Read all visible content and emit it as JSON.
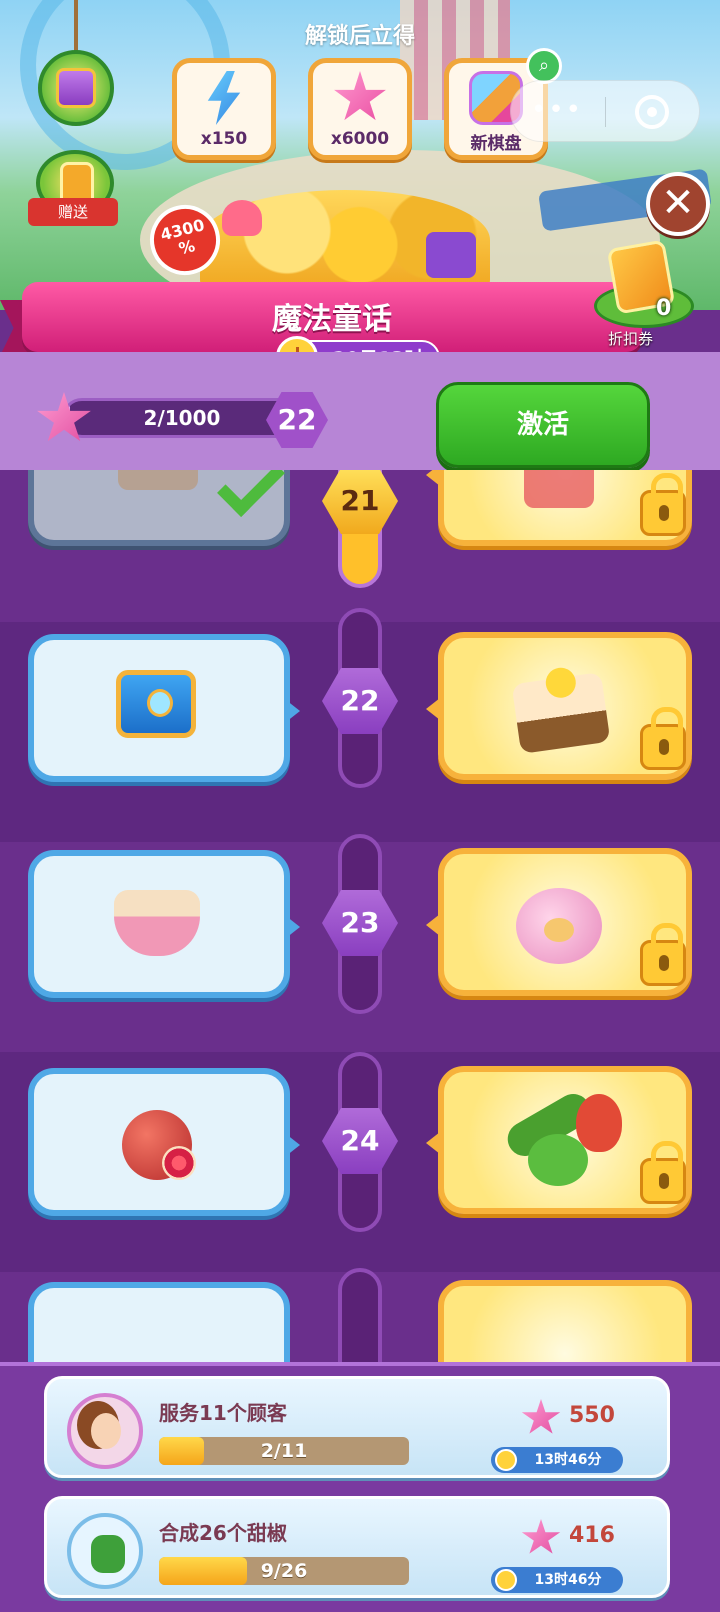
{
  "header": {
    "unlock_title": "解锁后立得",
    "rewards": [
      {
        "label": "x150",
        "icon": "energy-bolt-icon"
      },
      {
        "label": "x6000",
        "icon": "pink-star-icon"
      },
      {
        "label": "新棋盘",
        "icon": "new-board-icon"
      }
    ],
    "gift_label": "赠送",
    "percent_badge": "4300 %",
    "coupon": {
      "count": "0",
      "label": "折扣券"
    }
  },
  "event": {
    "title": "魔法童话",
    "time_left": "20日13时"
  },
  "progress": {
    "text": "2/1000",
    "value": 2,
    "max": 1000,
    "level": "22",
    "activate_label": "激活"
  },
  "levels": [
    {
      "level": "21",
      "free_item": "mystery-box-icon",
      "premium_item": "red-chest-icon",
      "claimed": true,
      "locked": true
    },
    {
      "level": "22",
      "free_item": "blue-chest-icon",
      "premium_item": "flower-cake-icon",
      "claimed": false,
      "locked": true
    },
    {
      "level": "23",
      "free_item": "rice-bowl-icon",
      "premium_item": "piggy-bank-icon",
      "claimed": false,
      "locked": true
    },
    {
      "level": "24",
      "free_item": "pomegranate-icon",
      "premium_item": "vegetables-icon",
      "claimed": false,
      "locked": true
    }
  ],
  "tasks": [
    {
      "title": "服务11个顾客",
      "progress_text": "2/11",
      "progress": 0.18,
      "reward": "550",
      "timer": "13时46分"
    },
    {
      "title": "合成26个甜椒",
      "progress_text": "9/26",
      "progress": 0.35,
      "reward": "416",
      "timer": "13时46分"
    }
  ],
  "colors": {
    "background": "#6a2f8c",
    "ribbon": "#d11f78",
    "activate": "#2ea922",
    "free_border": "#4fa8e6",
    "premium_border": "#f7b23b"
  }
}
